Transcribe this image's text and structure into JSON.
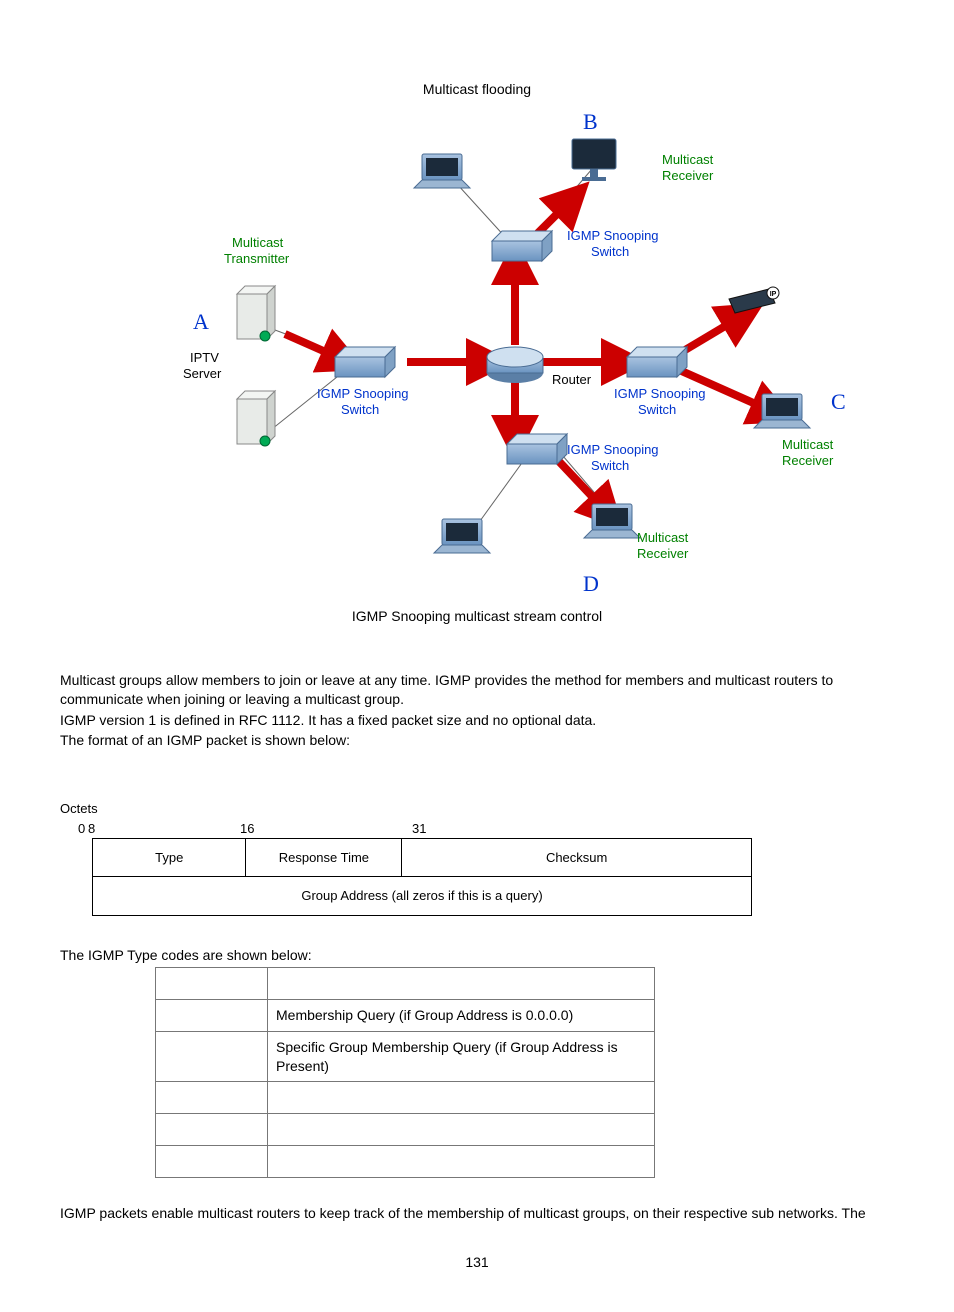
{
  "fig1_caption": "Multicast flooding",
  "fig2_caption": "IGMP Snooping multicast stream control",
  "diagram": {
    "labelA": "A",
    "labelB": "B",
    "labelC": "C",
    "labelD": "D",
    "iptv_l1": "IPTV",
    "iptv_l2": "Server",
    "multicast_tx_l1": "Multicast",
    "multicast_tx_l2": "Transmitter",
    "multicast_rx_l1": "Multicast",
    "multicast_rx_l2": "Receiver",
    "igmp_sw_l1": "IGMP Snooping",
    "igmp_sw_l2": "Switch",
    "router": "Router"
  },
  "para1": "Multicast groups allow members to join or leave at any time. IGMP provides the method for members and multicast routers to communicate when joining or leaving a multicast group.",
  "para2": "IGMP version 1 is defined in RFC 1112. It has a fixed packet size and no optional data.",
  "para3": "The format of an IGMP packet is shown below:",
  "octets_title": "Octets",
  "bits": {
    "b0": "0",
    "b8": "8",
    "b16": "16",
    "b31": "31"
  },
  "packet": {
    "type": "Type",
    "resp": "Response Time",
    "checksum": "Checksum",
    "group": "Group Address (all zeros if this is a query)"
  },
  "type_codes_title": "The IGMP Type codes are shown below:",
  "codes": [
    {
      "code": "",
      "desc": ""
    },
    {
      "code": "",
      "desc": "Membership Query (if Group Address is 0.0.0.0)"
    },
    {
      "code": "",
      "desc": "Specific Group Membership Query (if Group Address is Present)"
    },
    {
      "code": "",
      "desc": ""
    },
    {
      "code": "",
      "desc": ""
    },
    {
      "code": "",
      "desc": ""
    }
  ],
  "closing": "IGMP packets enable multicast routers to keep track of the membership of multicast groups, on their respective sub networks. The",
  "pagenum": "131"
}
